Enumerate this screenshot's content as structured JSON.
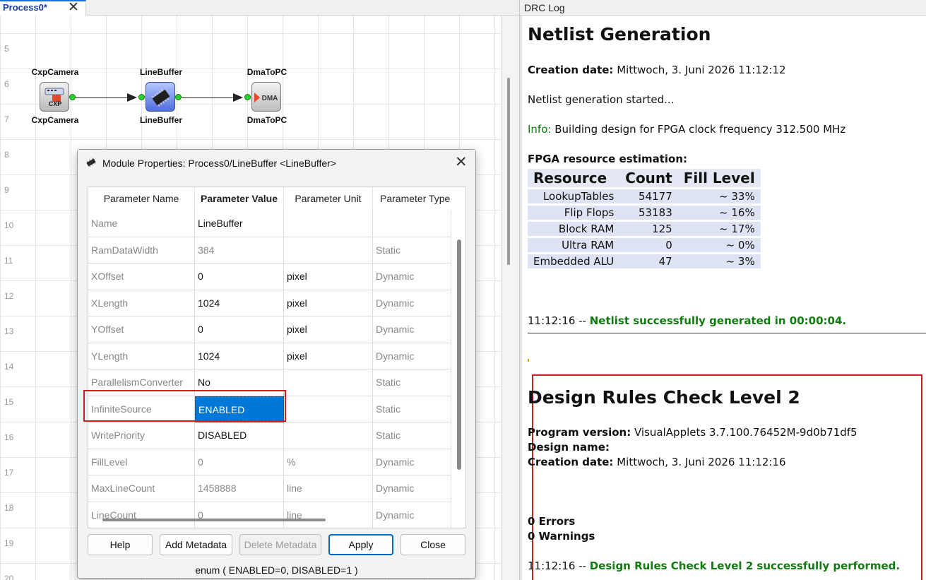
{
  "tab": {
    "title": "Process0*",
    "close": "✕"
  },
  "canvas": {
    "row_labels": [
      "5",
      "6",
      "7",
      "8",
      "9",
      "10",
      "11",
      "12",
      "13",
      "14",
      "15",
      "16",
      "17",
      "18",
      "19",
      "20"
    ],
    "modules": [
      {
        "top_label": "CxpCamera",
        "bottom_label": "CxpCamera",
        "icon": "cxp-camera-icon",
        "icon_text": "CXP"
      },
      {
        "top_label": "LineBuffer",
        "bottom_label": "LineBuffer",
        "icon": "line-buffer-chip-icon"
      },
      {
        "top_label": "DmaToPC",
        "bottom_label": "DmaToPC",
        "icon": "dma-icon",
        "icon_text": "DMA"
      }
    ]
  },
  "dialog": {
    "title": "Module Properties: Process0/LineBuffer <LineBuffer>",
    "columns": [
      "Parameter Name",
      "Parameter Value",
      "Parameter Unit",
      "Parameter Type"
    ],
    "rows": [
      {
        "name": "Name",
        "value": "LineBuffer",
        "unit": "",
        "type": "",
        "readonly": false
      },
      {
        "name": "RamDataWidth",
        "value": "384",
        "unit": "",
        "type": "Static",
        "readonly": true
      },
      {
        "name": "XOffset",
        "value": "0",
        "unit": "pixel",
        "type": "Dynamic",
        "readonly": false
      },
      {
        "name": "XLength",
        "value": "1024",
        "unit": "pixel",
        "type": "Dynamic",
        "readonly": false
      },
      {
        "name": "YOffset",
        "value": "0",
        "unit": "pixel",
        "type": "Dynamic",
        "readonly": false
      },
      {
        "name": "YLength",
        "value": "1024",
        "unit": "pixel",
        "type": "Dynamic",
        "readonly": false
      },
      {
        "name": "ParallelismConverter",
        "value": "No",
        "unit": "",
        "type": "Static",
        "readonly": false
      },
      {
        "name": "InfiniteSource",
        "value": "ENABLED",
        "unit": "",
        "type": "Static",
        "readonly": false,
        "selected": true
      },
      {
        "name": "WritePriority",
        "value": "DISABLED",
        "unit": "",
        "type": "Static",
        "readonly": false
      },
      {
        "name": "FillLevel",
        "value": "0",
        "unit": "%",
        "type": "Dynamic",
        "readonly": true
      },
      {
        "name": "MaxLineCount",
        "value": "1458888",
        "unit": "line",
        "type": "Dynamic",
        "readonly": true
      },
      {
        "name": "LineCount",
        "value": "0",
        "unit": "line",
        "type": "Dynamic",
        "readonly": true
      }
    ],
    "buttons": {
      "help": "Help",
      "add_metadata": "Add Metadata",
      "delete_metadata": "Delete Metadata",
      "apply": "Apply",
      "close": "Close"
    },
    "status": "enum ( ENABLED=0, DISABLED=1 )"
  },
  "drc_log": {
    "panel_title": "DRC Log",
    "netlist": {
      "heading": "Netlist Generation",
      "creation_label": "Creation date:",
      "creation_value": "Mittwoch, 3. Juni 2026 11:12:12",
      "started": "Netlist generation started...",
      "info_label": "Info:",
      "info_text": "Building design for FPGA clock frequency 312.500 MHz",
      "resource_heading": "FPGA resource estimation:",
      "table_headers": [
        "Resource",
        "Count",
        "Fill Level"
      ],
      "table_rows": [
        [
          "LookupTables",
          "54177",
          "~ 33%"
        ],
        [
          "Flip Flops",
          "53183",
          "~ 16%"
        ],
        [
          "Block RAM",
          "125",
          "~ 17%"
        ],
        [
          "Ultra RAM",
          "0",
          "~ 0%"
        ],
        [
          "Embedded ALU",
          "47",
          "~ 3%"
        ]
      ],
      "done_time": "11:12:16 --",
      "done_text": "Netlist successfully generated in 00:00:04."
    },
    "drc": {
      "heading": "Design Rules Check Level 2",
      "program_label": "Program version:",
      "program_value": "VisualApplets 3.7.100.76452M-9d0b71df5",
      "design_label": "Design name:",
      "creation_label": "Creation date:",
      "creation_value": "Mittwoch, 3. Juni 2026 11:12:16",
      "errors": "0 Errors",
      "warnings": "0 Warnings",
      "done_time": "11:12:16 --",
      "done_text": "Design Rules Check Level 2 successfully performed."
    }
  }
}
